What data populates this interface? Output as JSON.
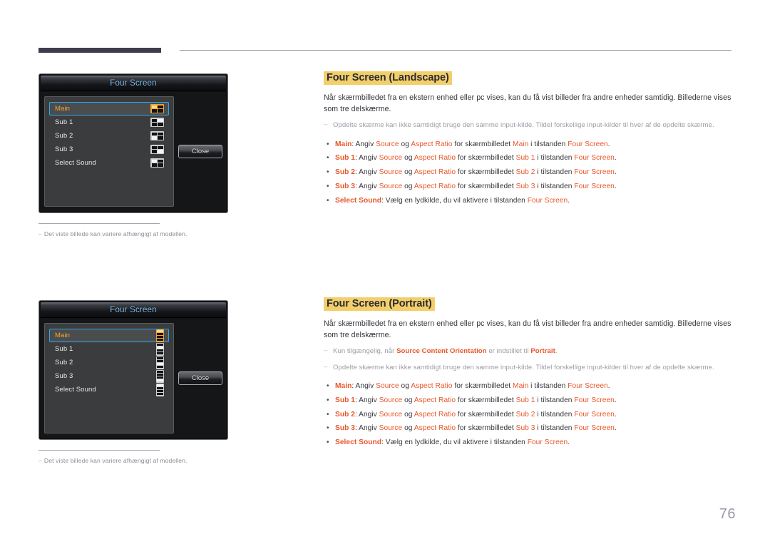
{
  "page": {
    "number": "76"
  },
  "figures": [
    {
      "id": "landscape",
      "title": "Four Screen",
      "close_label": "Close",
      "caption": "Det viste billede kan variere afhængigt af modellen.",
      "orientation": "landscape",
      "items": [
        {
          "label": "Main",
          "selected": true,
          "icon": "quad-icon-top-left-active",
          "highlight": 0
        },
        {
          "label": "Sub 1",
          "selected": false,
          "icon": "quad-icon-top-right-active",
          "highlight": 1
        },
        {
          "label": "Sub 2",
          "selected": false,
          "icon": "quad-icon-bottom-left-active",
          "highlight": 2
        },
        {
          "label": "Sub 3",
          "selected": false,
          "icon": "quad-icon-bottom-right-active",
          "highlight": 3
        },
        {
          "label": "Select Sound",
          "selected": false,
          "icon": "quad-icon-top-left-active",
          "highlight": 0
        }
      ]
    },
    {
      "id": "portrait",
      "title": "Four Screen",
      "close_label": "Close",
      "caption": "Det viste billede kan variere afhængigt af modellen.",
      "orientation": "portrait",
      "items": [
        {
          "label": "Main",
          "selected": true,
          "icon": "stack-icon-row1-active",
          "highlight": 0
        },
        {
          "label": "Sub 1",
          "selected": false,
          "icon": "stack-icon-row2-active",
          "highlight": 1
        },
        {
          "label": "Sub 2",
          "selected": false,
          "icon": "stack-icon-row3-active",
          "highlight": 2
        },
        {
          "label": "Sub 3",
          "selected": false,
          "icon": "stack-icon-row4-active",
          "highlight": 3
        },
        {
          "label": "Select Sound",
          "selected": false,
          "icon": "stack-icon-row1-active",
          "highlight": 0
        }
      ]
    }
  ],
  "sections": [
    {
      "id": "landscape",
      "heading": "Four Screen (Landscape)",
      "lead": "Når skærmbilledet fra en ekstern enhed eller pc vises, kan du få vist billeder fra andre enheder samtidig. Billederne vises som tre delskærme.",
      "notes": [
        "Opdelte skærme kan ikke samtidigt bruge den samme input-kilde. Tildel forskellige input-kilder til hver af de opdelte skærme."
      ],
      "bullets": [
        {
          "term": "Main",
          "t1": ": Angiv ",
          "k1": "Source",
          "t2": " og ",
          "k2": "Aspect Ratio",
          "t3": " for skærmbilledet ",
          "k3": "Main",
          "t4": " i tilstanden ",
          "k4": "Four Screen",
          "t5": "."
        },
        {
          "term": "Sub 1",
          "t1": ": Angiv ",
          "k1": "Source",
          "t2": " og ",
          "k2": "Aspect Ratio",
          "t3": " for skærmbilledet ",
          "k3": "Sub 1",
          "t4": " i tilstanden ",
          "k4": "Four Screen",
          "t5": "."
        },
        {
          "term": "Sub 2",
          "t1": ": Angiv ",
          "k1": "Source",
          "t2": " og ",
          "k2": "Aspect Ratio",
          "t3": " for skærmbilledet ",
          "k3": "Sub 2",
          "t4": " i tilstanden ",
          "k4": "Four Screen",
          "t5": "."
        },
        {
          "term": "Sub 3",
          "t1": ": Angiv ",
          "k1": "Source",
          "t2": " og ",
          "k2": "Aspect Ratio",
          "t3": " for skærmbilledet ",
          "k3": "Sub 3",
          "t4": " i tilstanden ",
          "k4": "Four Screen",
          "t5": "."
        },
        {
          "term": "Select Sound",
          "t1": ": Vælg en lydkilde, du vil aktivere i tilstanden ",
          "k1": "",
          "t2": "",
          "k2": "",
          "t3": "",
          "k3": "",
          "t4": "",
          "k4": "Four Screen",
          "t5": "."
        }
      ]
    },
    {
      "id": "portrait",
      "heading": "Four Screen (Portrait)",
      "lead": "Når skærmbilledet fra en ekstern enhed eller pc vises, kan du få vist billeder fra andre enheder samtidig. Billederne vises som tre delskærme.",
      "notes": [
        "Kun tilgængelig, når Source Content Orientation er indstillet til Portrait.",
        "Opdelte skærme kan ikke samtidigt bruge den samme input-kilde. Tildel forskellige input-kilder til hver af de opdelte skærme."
      ],
      "note_keys": {
        "n0_k1": "Source Content Orientation",
        "n0_k2": "Portrait"
      },
      "note_texts": {
        "n0_a": "Kun tilgængelig, når ",
        "n0_b": " er indstillet til ",
        "n0_c": "."
      },
      "bullets": [
        {
          "term": "Main",
          "t1": ": Angiv ",
          "k1": "Source",
          "t2": " og ",
          "k2": "Aspect Ratio",
          "t3": " for skærmbilledet ",
          "k3": "Main",
          "t4": " i tilstanden ",
          "k4": "Four Screen",
          "t5": "."
        },
        {
          "term": "Sub 1",
          "t1": ": Angiv ",
          "k1": "Source",
          "t2": " og ",
          "k2": "Aspect Ratio",
          "t3": " for skærmbilledet ",
          "k3": "Sub 1",
          "t4": " i tilstanden ",
          "k4": "Four Screen",
          "t5": "."
        },
        {
          "term": "Sub 2",
          "t1": ": Angiv ",
          "k1": "Source",
          "t2": " og ",
          "k2": "Aspect Ratio",
          "t3": " for skærmbilledet ",
          "k3": "Sub 2",
          "t4": " i tilstanden ",
          "k4": "Four Screen",
          "t5": "."
        },
        {
          "term": "Sub 3",
          "t1": ": Angiv ",
          "k1": "Source",
          "t2": " og ",
          "k2": "Aspect Ratio",
          "t3": " for skærmbilledet ",
          "k3": "Sub 3",
          "t4": " i tilstanden ",
          "k4": "Four Screen",
          "t5": "."
        },
        {
          "term": "Select Sound",
          "t1": ": Vælg en lydkilde, du vil aktivere i tilstanden ",
          "k1": "",
          "t2": "",
          "k2": "",
          "t3": "",
          "k3": "",
          "t4": "",
          "k4": "Four Screen",
          "t5": "."
        }
      ]
    }
  ],
  "colors": {
    "heading_highlight": "#f2cf6a",
    "keyword": "#e8572a",
    "osd_selected_text": "#f0a830",
    "osd_selected_border": "#2ea7e8",
    "osd_title_text": "#7fbbe8",
    "rule_dark": "#403c4e"
  }
}
